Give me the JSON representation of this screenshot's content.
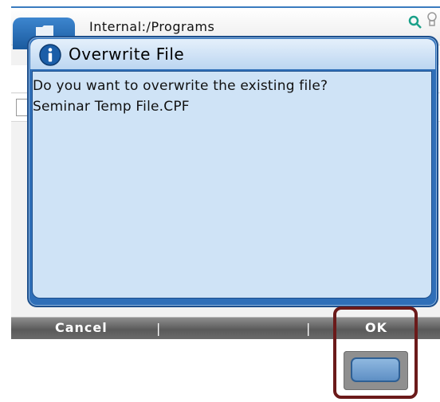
{
  "window": {
    "path": "Internal:/Programs",
    "icons": [
      "folder-icon",
      "search-icon",
      "bulb-icon"
    ]
  },
  "dialog": {
    "icon": "info-icon",
    "title": "Overwrite File",
    "message_line1": "Do you want to overwrite the existing file?",
    "message_line2": "Seminar Temp File.CPF"
  },
  "softkeys": {
    "cancel": "Cancel",
    "ok": "OK",
    "separator": "|"
  },
  "colors": {
    "dialog_frame": "#2f6fb8",
    "dialog_body": "#cfe3f6",
    "highlight": "#6b1a1a"
  }
}
